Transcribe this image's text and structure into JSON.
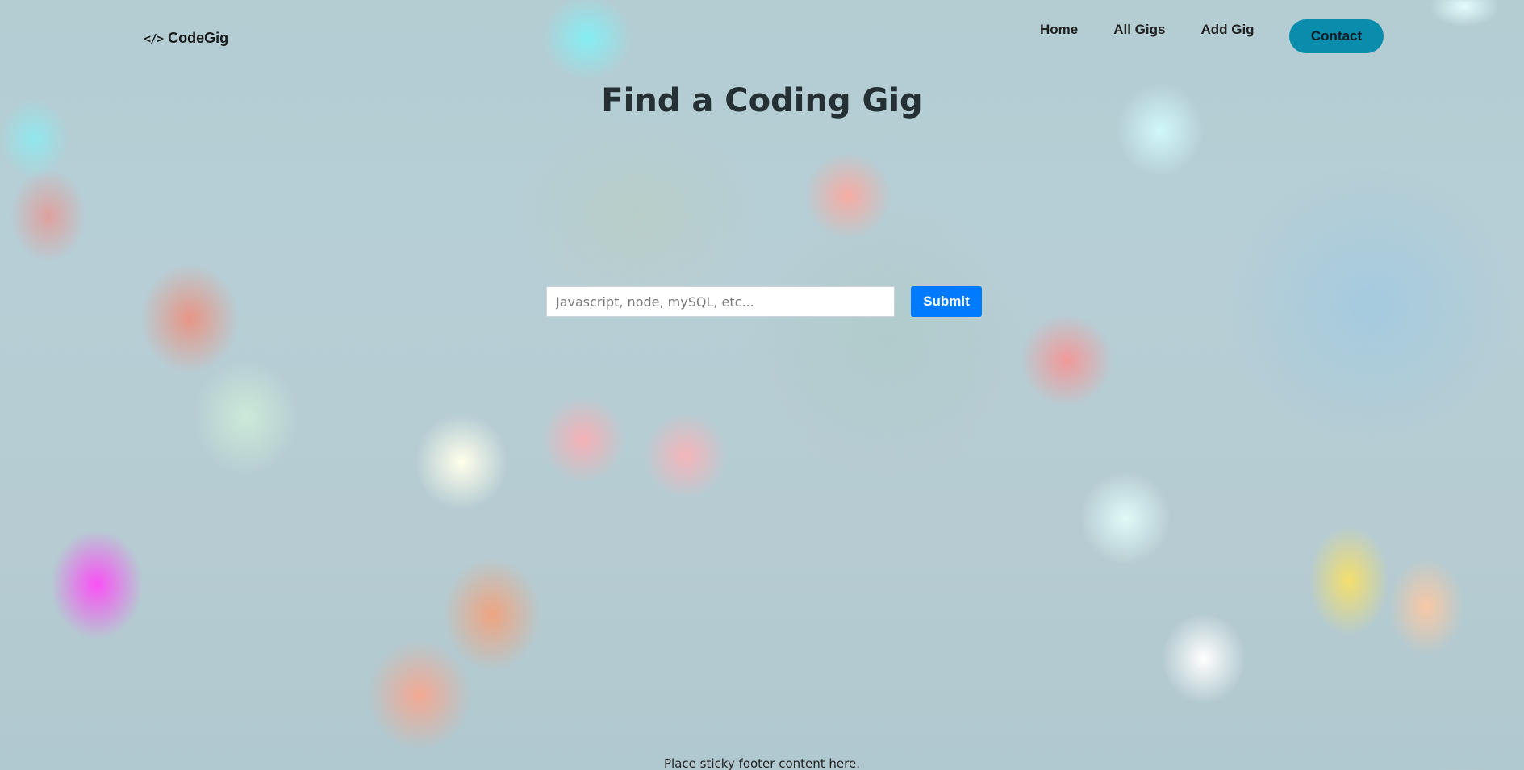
{
  "navbar": {
    "brand": {
      "icon": "code-icon",
      "icon_glyph": "</>",
      "label": "CodeGig"
    },
    "links": [
      {
        "label": "Home"
      },
      {
        "label": "All Gigs"
      },
      {
        "label": "Add Gig"
      }
    ],
    "contact_label": "Contact"
  },
  "main": {
    "title": "Find a Coding Gig",
    "search": {
      "value": "",
      "placeholder": "Javascript, node, mySQL, etc...",
      "submit_label": "Submit"
    }
  },
  "footer": {
    "text": "Place sticky footer content here."
  },
  "colors": {
    "contact_button": "#0a8cac",
    "submit_button": "#007bff",
    "text": "#222222"
  }
}
